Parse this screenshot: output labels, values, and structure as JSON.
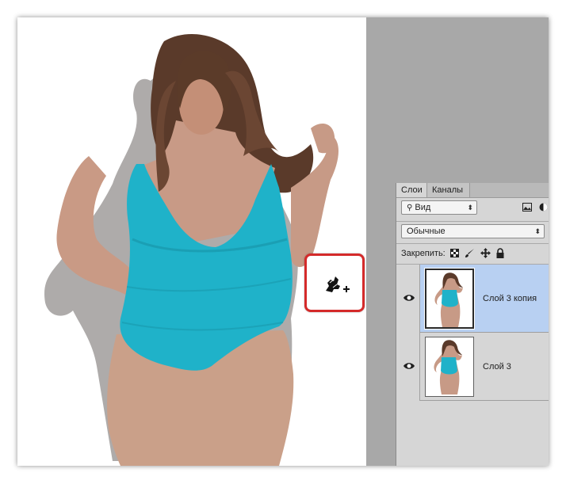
{
  "layers_panel": {
    "tabs": [
      "Слои",
      "Каналы"
    ],
    "filter_kind": "Вид",
    "blend_mode": "Обычные",
    "lock_label": "Закрепить:",
    "layers": [
      {
        "name": "Слой 3 копия",
        "selected": true
      },
      {
        "name": "Слой 3",
        "selected": false
      }
    ]
  },
  "colors": {
    "callout_border": "#d42a2a",
    "selected_layer": "#b8d0f2",
    "swimsuit": "#1fb2c9",
    "panel_bg": "#d6d6d6"
  },
  "icons": {
    "callout_cursor": "stamp-cursor-icon",
    "visibility": "eye-icon",
    "search": "search-icon"
  }
}
